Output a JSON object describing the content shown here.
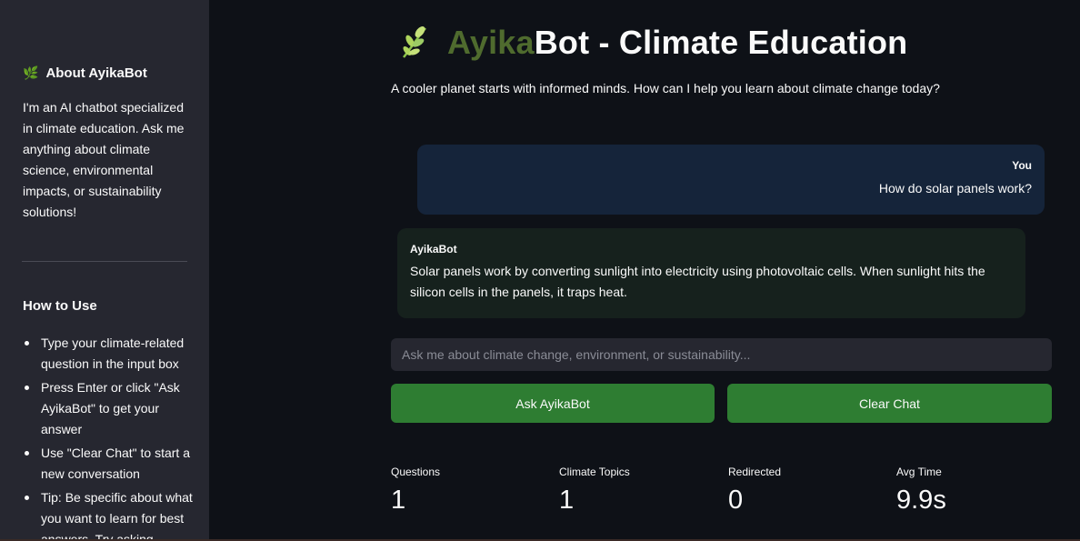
{
  "sidebar": {
    "about_title": "About AyikaBot",
    "about_text": "I'm an AI chatbot specialized in climate education. Ask me anything about climate science, environmental impacts, or sustainability solutions!",
    "howto_title": "How to Use",
    "howto_items": [
      "Type your climate-related question in the input box",
      "Press Enter or click \"Ask AyikaBot\" to get your answer",
      "Use \"Clear Chat\" to start a new conversation",
      "Tip: Be specific about what you want to learn for best answers. Try asking"
    ]
  },
  "header": {
    "title_part1": "Ayika",
    "title_part2": "Bot - Climate Education",
    "subtitle": "A cooler planet starts with informed minds. How can I help you learn about climate change today?"
  },
  "chat": {
    "user_label": "You",
    "user_message": "How do solar panels work?",
    "bot_label": "AyikaBot",
    "bot_message": "Solar panels work by converting sunlight into electricity using photovoltaic cells. When sunlight hits the silicon cells in the panels, it traps heat."
  },
  "input": {
    "placeholder": "Ask me about climate change, environment, or sustainability..."
  },
  "buttons": {
    "ask": "Ask AyikaBot",
    "clear": "Clear Chat"
  },
  "metrics": [
    {
      "label": "Questions",
      "value": "1"
    },
    {
      "label": "Climate Topics",
      "value": "1"
    },
    {
      "label": "Redirected",
      "value": "0"
    },
    {
      "label": "Avg Time",
      "value": "9.9s"
    }
  ],
  "colors": {
    "accent_green": "#2e7d32",
    "title_ayika_green": "#4f6b2e",
    "title_ayika_brown": "#8a5a32"
  },
  "icons": {
    "leaf": "leaf-icon"
  }
}
